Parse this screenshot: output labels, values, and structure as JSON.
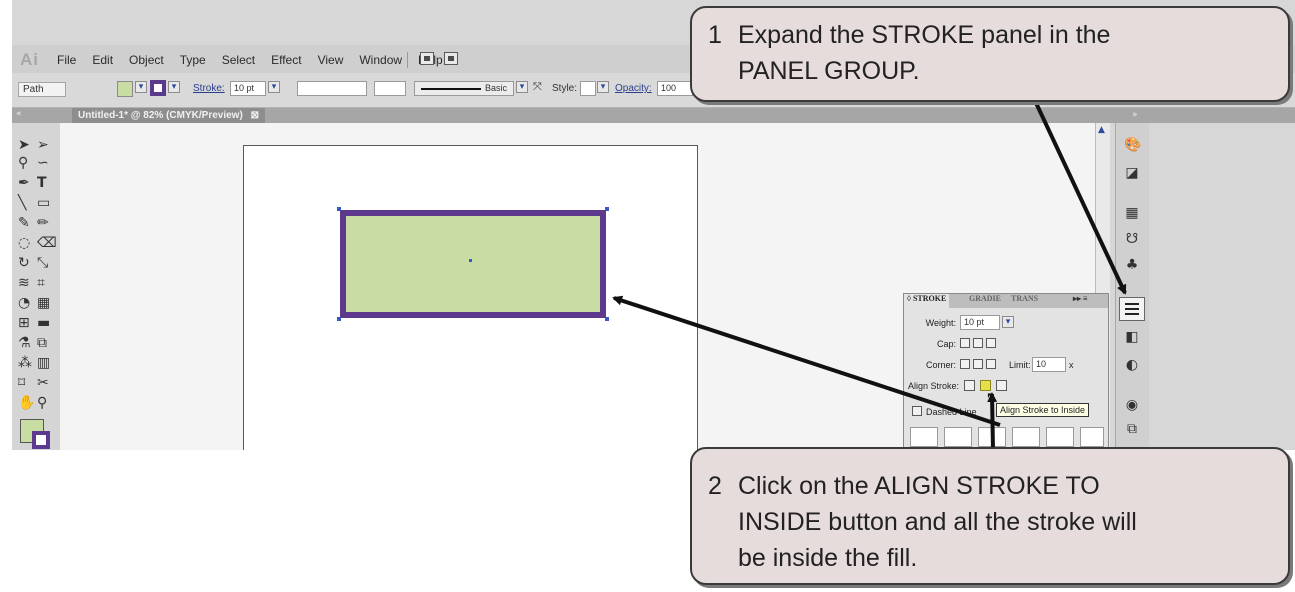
{
  "app": {
    "logo": "Ai",
    "menu": [
      "File",
      "Edit",
      "Object",
      "Type",
      "Select",
      "Effect",
      "View",
      "Window",
      "Help"
    ]
  },
  "control_bar": {
    "selection": "Path",
    "stroke_label": "Stroke:",
    "stroke_weight": "10 pt",
    "line_style": "Basic",
    "style_label": "Style:",
    "opacity_label": "Opacity:",
    "opacity_value": "100"
  },
  "document_tab": "Untitled-1* @ 82% (CMYK/Preview)",
  "colors": {
    "fill": "#c8dca4",
    "stroke": "#5d3a8e"
  },
  "stroke_panel": {
    "tabs": [
      "STROKE",
      "GRADIE",
      "TRANS"
    ],
    "weight_label": "Weight:",
    "weight_value": "10 pt",
    "cap_label": "Cap:",
    "corner_label": "Corner:",
    "limit_label": "Limit:",
    "limit_value": "10",
    "limit_unit": "x",
    "align_label": "Align Stroke:",
    "dashed_label": "Dashed Line",
    "tooltip": "Align Stroke to Inside"
  },
  "callouts": [
    {
      "number": "1",
      "lines": [
        "Expand the STROKE panel in the",
        "PANEL GROUP."
      ]
    },
    {
      "number": "2",
      "lines": [
        "Click on the ALIGN STROKE TO",
        "INSIDE button and all the stroke will",
        "be inside the fill."
      ]
    }
  ]
}
